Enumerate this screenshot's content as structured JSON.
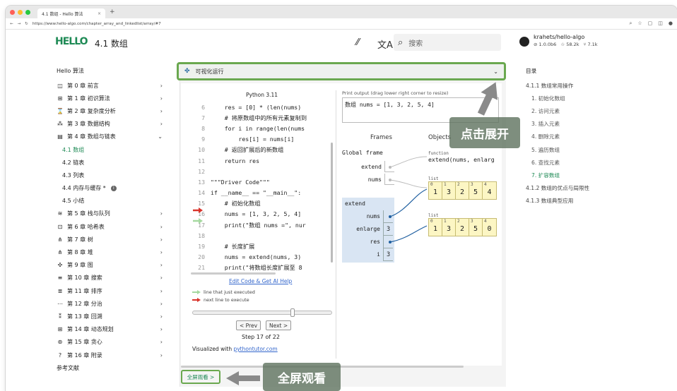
{
  "browser": {
    "tab_title": "4.1 数组 - Hello 算法",
    "tab_close": "×",
    "new_tab": "+",
    "url": "https://www.hello-algo.com/chapter_array_and_linkedlist/array/#7",
    "colors": {
      "red": "#ff5f57",
      "yellow": "#febc2e",
      "green": "#28c840"
    }
  },
  "header": {
    "logo_text": "HELLO",
    "title": "4.1   数组",
    "search_placeholder": "搜索",
    "repo_name": "krahets/hello-algo",
    "repo_version": "1.0.0b6",
    "repo_stars": "58.2k",
    "repo_forks": "7.1k"
  },
  "leftnav": {
    "root": "Hello 算法",
    "chapters": [
      {
        "icon": "◫",
        "label": "第 0 章   前言",
        "chev": "›"
      },
      {
        "icon": "⊞",
        "label": "第 1 章   初识算法",
        "chev": "›"
      },
      {
        "icon": "⌛",
        "label": "第 2 章   复杂度分析",
        "chev": "›"
      },
      {
        "icon": "⁂",
        "label": "第 3 章   数据结构",
        "chev": "›"
      },
      {
        "icon": "▤",
        "label": "第 4 章   数组与链表",
        "chev": "⌄"
      }
    ],
    "subs": [
      {
        "label": "4.1   数组"
      },
      {
        "label": "4.2   链表"
      },
      {
        "label": "4.3   列表"
      },
      {
        "label": "4.4   内存与缓存 *"
      },
      {
        "label": "4.5   小结"
      }
    ],
    "chapters2": [
      {
        "icon": "≋",
        "label": "第 5 章   栈与队列",
        "chev": "›"
      },
      {
        "icon": "⊡",
        "label": "第 6 章   哈希表",
        "chev": "›"
      },
      {
        "icon": "⋔",
        "label": "第 7 章   树",
        "chev": "›"
      },
      {
        "icon": "⋔",
        "label": "第 8 章   堆",
        "chev": "›"
      },
      {
        "icon": "✣",
        "label": "第 9 章   图",
        "chev": "›"
      },
      {
        "icon": "≡",
        "label": "第 10 章   搜索",
        "chev": "›"
      },
      {
        "icon": "≣",
        "label": "第 11 章   排序",
        "chev": "›"
      },
      {
        "icon": "⋯",
        "label": "第 12 章   分治",
        "chev": "›"
      },
      {
        "icon": "⁑",
        "label": "第 13 章   回溯",
        "chev": "›"
      },
      {
        "icon": "⊞",
        "label": "第 14 章   动态规划",
        "chev": "›"
      },
      {
        "icon": "⊛",
        "label": "第 15 章   贪心",
        "chev": "›"
      },
      {
        "icon": "?",
        "label": "第 16 章   附录",
        "chev": "›"
      }
    ],
    "refs": "参考文献"
  },
  "panel": {
    "title": "可视化运行",
    "collapse": "⌄",
    "code_title": "Python 3.11",
    "code_lines": [
      {
        "n": "6",
        "code": "    res = [0] * (len(nums)"
      },
      {
        "n": "7",
        "code": "    # 将原数组中的所有元素复制到"
      },
      {
        "n": "8",
        "code": "    for i in range(len(nums"
      },
      {
        "n": "9",
        "code": "        res[i] = nums[i]"
      },
      {
        "n": "10",
        "code": "    # 返回扩展后的新数组"
      },
      {
        "n": "11",
        "code": "    return res"
      },
      {
        "n": "12",
        "code": ""
      },
      {
        "n": "13",
        "code": "\"\"\"Driver Code\"\"\""
      },
      {
        "n": "14",
        "code": "if __name__ == \"__main__\":"
      },
      {
        "n": "15",
        "code": "    # 初始化数组"
      },
      {
        "n": "16",
        "code": "    nums = [1, 3, 2, 5, 4]"
      },
      {
        "n": "17",
        "code": "    print(\"数组 nums =\", nur"
      },
      {
        "n": "18",
        "code": ""
      },
      {
        "n": "19",
        "code": "    # 长度扩展"
      },
      {
        "n": "20",
        "code": "    nums = extend(nums, 3)"
      },
      {
        "n": "21",
        "code": "    print(\"将数组长度扩展至 8"
      }
    ],
    "edit_link": "Edit Code & Get AI Help",
    "legend_green": "line that just executed",
    "legend_red": "next line to execute",
    "prev": "< Prev",
    "next": "Next >",
    "step": "Step 17 of 22",
    "visualized_prefix": "Visualized with ",
    "visualized_link": "pythontutor.com",
    "print_label": "Print output (drag lower right corner to resize)",
    "print_output": "数组 nums = [1, 3, 2, 5, 4]",
    "frames": "Frames",
    "objects": "Objects",
    "global_frame": "Global frame",
    "g_extend": "extend",
    "g_nums": "nums",
    "fn_label": "function",
    "fn_sig": "extend(nums, enlarg",
    "list_label": "list",
    "list1": [
      1,
      3,
      2,
      5,
      4
    ],
    "list2": [
      1,
      3,
      2,
      5,
      0
    ],
    "e_frame": "extend",
    "e_nums": "nums",
    "e_enlarge": "enlarge",
    "e_enlarge_val": "3",
    "e_res": "res",
    "e_i": "i",
    "e_i_val": "3",
    "fullscreen": "全屏观看 >"
  },
  "annotations": {
    "expand": "点击展开",
    "fullscreen": "全屏观看"
  },
  "toc": {
    "title": "目录",
    "items": [
      {
        "label": "4.1.1   数组常用操作",
        "type": "l1"
      },
      {
        "label": "1.   初始化数组",
        "type": "sub"
      },
      {
        "label": "2.   访问元素",
        "type": "sub"
      },
      {
        "label": "3.   插入元素",
        "type": "sub"
      },
      {
        "label": "4.   删除元素",
        "type": "sub"
      },
      {
        "label": "5.   遍历数组",
        "type": "sub"
      },
      {
        "label": "6.   查找元素",
        "type": "sub"
      },
      {
        "label": "7.   扩容数组",
        "type": "active"
      },
      {
        "label": "4.1.2   数组的优点与局限性",
        "type": "l1"
      },
      {
        "label": "4.1.3   数组典型应用",
        "type": "l1"
      }
    ]
  }
}
